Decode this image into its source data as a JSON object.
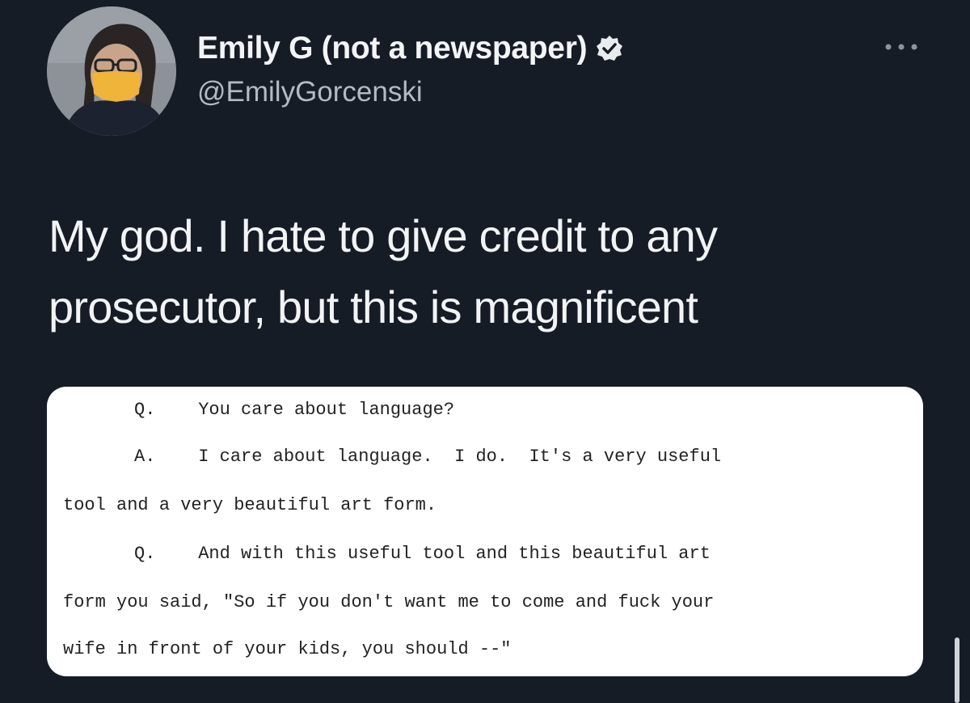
{
  "author": {
    "display_name": "Emily G (not a newspaper)",
    "handle": "@EmilyGorcenski",
    "verified": true
  },
  "icons": {
    "verified": "verified-badge-icon",
    "more": "more-options-icon"
  },
  "tweet": {
    "text_lines": [
      "My god. I hate to give credit to any",
      "prosecutor, but this is magnificent"
    ]
  },
  "transcript": {
    "lines": [
      "Q.    You care about language?",
      "A.    I care about language.  I do.  It's a very useful",
      "tool and a very beautiful art form.",
      "Q.    And with this useful tool and this beautiful art",
      "form you said, \"So if you don't want me to come and fuck your",
      "wife in front of your kids, you should --\""
    ]
  },
  "colors": {
    "background": "#161c26",
    "text": "#f1f3f5",
    "secondary_text": "#b3bac2",
    "card": "#ffffff"
  }
}
